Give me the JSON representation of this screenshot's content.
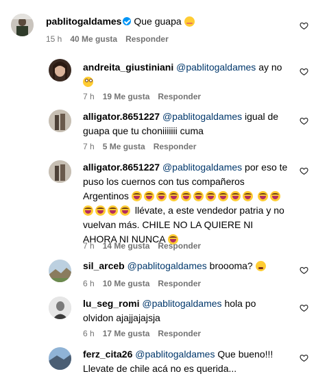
{
  "comments": [
    {
      "username": "pablitogaldames",
      "verified": true,
      "mention": "",
      "text": "Que guapa",
      "time": "15 h",
      "likes": "40 Me gusta",
      "reply": "Responder"
    },
    {
      "username": "andreita_giustiniani",
      "mention": "@pablitogaldames",
      "text": "ay no",
      "time": "7 h",
      "likes": "19 Me gusta",
      "reply": "Responder"
    },
    {
      "username": "alligator.8651227",
      "mention": "@pablitogaldames",
      "text": "igual de guapa que tu choniiiiiii cuma",
      "time": "7 h",
      "likes": "5 Me gusta",
      "reply": "Responder"
    },
    {
      "username": "alligator.8651227",
      "mention": "@pablitogaldames",
      "text": "por eso te puso los cuernos con tus compañeros Argentinos",
      "text_after": "llévate, a este vendedor patria y no vuelvan más. CHILE NO LA QUIERE NI AHORA NI NUNCA",
      "time": "7 h",
      "likes": "14 Me gusta",
      "reply": "Responder"
    },
    {
      "username": "sil_arceb",
      "mention": "@pablitogaldames",
      "text": "broooma?",
      "time": "6 h",
      "likes": "10 Me gusta",
      "reply": "Responder"
    },
    {
      "username": "lu_seg_romi",
      "mention": "@pablitogaldames",
      "text": "hola po olvidon ajajjajajsja",
      "time": "6 h",
      "likes": "17 Me gusta",
      "reply": "Responder"
    },
    {
      "username": "ferz_cita26",
      "mention": "@pablitogaldames",
      "text": "Que bueno!!! Llevate de chile acá no es querida..."
    }
  ],
  "icons": {
    "heart": "heart-outline-icon",
    "verified": "verified-badge-icon"
  },
  "colors": {
    "mention": "#00376b",
    "meta": "#737373",
    "verified": "#0095f6"
  }
}
